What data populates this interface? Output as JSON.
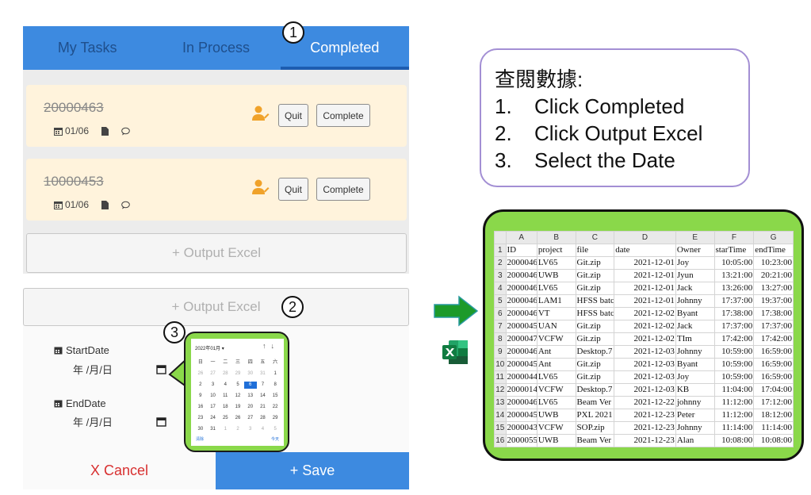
{
  "tabs": [
    "My Tasks",
    "In Process",
    "Completed"
  ],
  "tasks": [
    {
      "id": "20000463",
      "date": "01/06",
      "quit": "Quit",
      "complete": "Complete"
    },
    {
      "id": "10000453",
      "date": "01/06",
      "quit": "Quit",
      "complete": "Complete"
    }
  ],
  "output_excel": "+ Output Excel",
  "form": {
    "start_label": "StartDate",
    "start_placeholder": "年 /月/日",
    "end_label": "EndDate",
    "end_placeholder": "年 /月/日"
  },
  "footer": {
    "cancel": "X Cancel",
    "save": "+ Save"
  },
  "steps": [
    "1",
    "2",
    "3"
  ],
  "calendar": {
    "month": "2022年01月 ▾",
    "nav": "↑↓",
    "weekdays": [
      "日",
      "一",
      "二",
      "三",
      "四",
      "五",
      "六"
    ],
    "days": [
      [
        "26",
        "27",
        "28",
        "29",
        "30",
        "31",
        "1"
      ],
      [
        "2",
        "3",
        "4",
        "5",
        "6",
        "7",
        "8"
      ],
      [
        "9",
        "10",
        "11",
        "12",
        "13",
        "14",
        "15"
      ],
      [
        "16",
        "17",
        "18",
        "19",
        "20",
        "21",
        "22"
      ],
      [
        "23",
        "24",
        "25",
        "26",
        "27",
        "28",
        "29"
      ],
      [
        "30",
        "31",
        "1",
        "2",
        "3",
        "4",
        "5"
      ]
    ],
    "selected": "6",
    "clear": "清除",
    "today": "今天"
  },
  "note": {
    "title": "查閱數據:",
    "items": [
      {
        "n": "1.",
        "text": "Click Completed"
      },
      {
        "n": "2.",
        "text": "Click Output Excel"
      },
      {
        "n": "3.",
        "text": "Select the Date"
      }
    ]
  },
  "icons": [
    "calendar-icon",
    "file-icon",
    "comment-icon",
    "assign-user-icon",
    "arrow-right-icon",
    "excel-icon"
  ],
  "colors": {
    "primary": "#3d8ae0",
    "task_bg": "#fff3dc",
    "highlight": "#8ad84a",
    "cancel": "#d83030",
    "note_border": "#a38fd4"
  },
  "sheet": {
    "columns": [
      "A",
      "B",
      "C",
      "D",
      "E",
      "F",
      "G"
    ],
    "rows": [
      [
        "1",
        "ID",
        "project",
        "file",
        "date",
        "Owner",
        "starTime",
        "endTime"
      ],
      [
        "2",
        "20000463",
        "LV65",
        "Git.zip",
        "2021-12-01",
        "Joy",
        "10:05:00",
        "10:23:00"
      ],
      [
        "3",
        "20000466",
        "UWB",
        "Git.zip",
        "2021-12-01",
        "Jyun",
        "13:21:00",
        "20:21:00"
      ],
      [
        "4",
        "20000463",
        "LV65",
        "Git.zip",
        "2021-12-01",
        "Jack",
        "13:26:00",
        "13:27:00"
      ],
      [
        "5",
        "20000468",
        "LAM1",
        "HFSS batc",
        "2021-12-01",
        "Johnny",
        "17:37:00",
        "19:37:00"
      ],
      [
        "6",
        "20000463",
        "VT",
        "HFSS batc",
        "2021-12-02",
        "Byant",
        "17:38:00",
        "17:38:00"
      ],
      [
        "7",
        "20000450",
        "UAN",
        "Git.zip",
        "2021-12-02",
        "Jack",
        "17:37:00",
        "17:37:00"
      ],
      [
        "8",
        "20000472",
        "VCFW",
        "Git.zip",
        "2021-12-02",
        "TIm",
        "17:42:00",
        "17:42:00"
      ],
      [
        "9",
        "20000463",
        "Ant",
        "Desktop.7",
        "2021-12-03",
        "Johnny",
        "10:59:00",
        "16:59:00"
      ],
      [
        "10",
        "20000455",
        "Ant",
        "Git.zip",
        "2021-12-03",
        "Byant",
        "10:59:00",
        "16:59:00"
      ],
      [
        "11",
        "20000445",
        "LV65",
        "Git.zip",
        "2021-12-03",
        "Joy",
        "10:59:00",
        "16:59:00"
      ],
      [
        "12",
        "20000141",
        "VCFW",
        "Desktop.7",
        "2021-12-03",
        "KB",
        "11:04:00",
        "17:04:00"
      ],
      [
        "13",
        "20000463",
        "LV65",
        "Beam Ver",
        "2021-12-22",
        "johnny",
        "11:12:00",
        "17:12:00"
      ],
      [
        "14",
        "20000455",
        "UWB",
        "PXL 2021",
        "2021-12-23",
        "Peter",
        "11:12:00",
        "18:12:00"
      ],
      [
        "15",
        "20000433",
        "VCFW",
        "SOP.zip",
        "2021-12-23",
        "Johnny",
        "11:14:00",
        "11:14:00"
      ],
      [
        "16",
        "20000555",
        "UWB",
        "Beam Ver",
        "2021-12-23",
        "Alan",
        "10:08:00",
        "10:08:00"
      ]
    ]
  }
}
